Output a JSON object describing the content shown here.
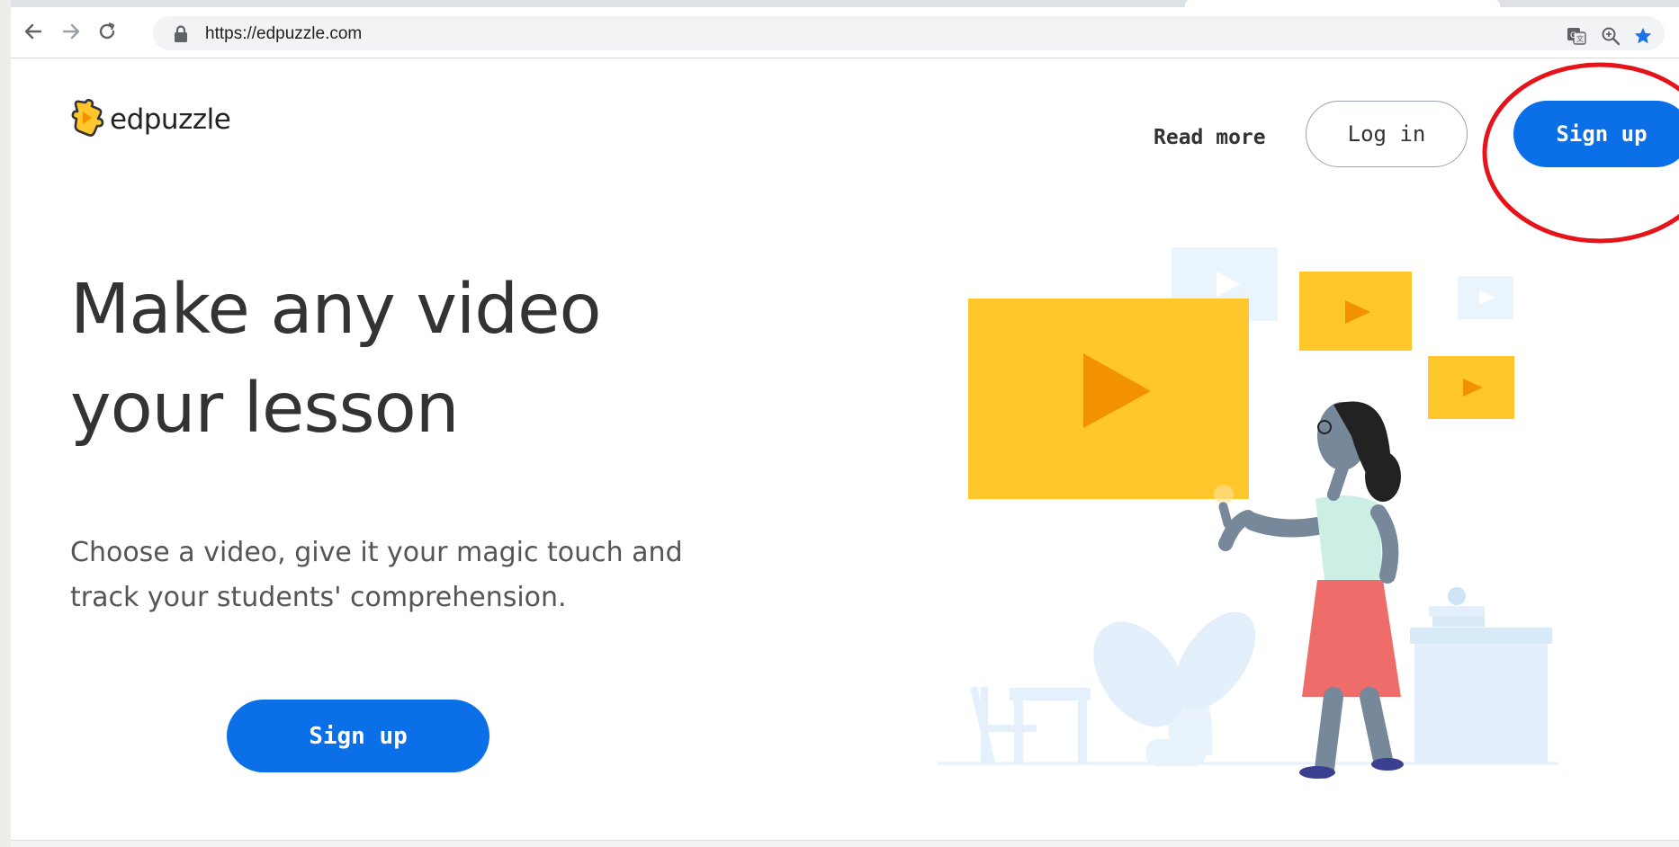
{
  "browser": {
    "url": "https://edpuzzle.com",
    "icons": {
      "back": "back-arrow-icon",
      "forward": "forward-arrow-icon",
      "reload": "reload-icon",
      "lock": "lock-icon",
      "translate": "translate-icon",
      "zoom": "zoom-icon",
      "bookmark": "star-icon"
    }
  },
  "header": {
    "logo_text": "edpuzzle",
    "read_more": "Read more",
    "login": "Log in",
    "signup": "Sign up"
  },
  "hero": {
    "title_line1": "Make any video",
    "title_line2": "your lesson",
    "subtitle_line1": "Choose a video, give it your magic touch and",
    "subtitle_line2": "track your students' comprehension.",
    "cta": "Sign up"
  },
  "colors": {
    "primary": "#0b6fe8",
    "accent_yellow": "#ffc72c",
    "annotation_red": "#e5141b"
  }
}
